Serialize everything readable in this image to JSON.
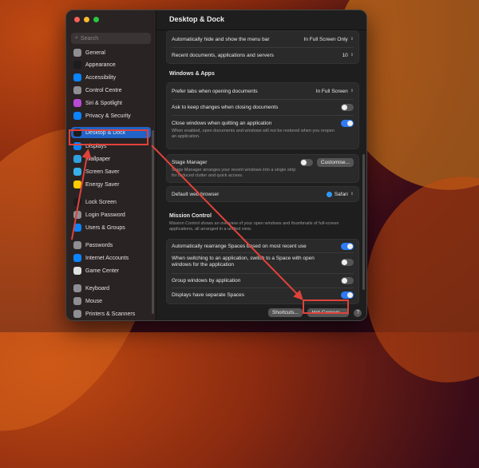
{
  "window": {
    "title": "Desktop & Dock"
  },
  "sidebar": {
    "search_placeholder": "Search",
    "items": [
      {
        "label": "General",
        "icon": "gear-icon",
        "color": "#8e8e93"
      },
      {
        "label": "Appearance",
        "icon": "appearance-icon",
        "color": "#1c1c1e"
      },
      {
        "label": "Accessibility",
        "icon": "accessibility-icon",
        "color": "#0a84ff"
      },
      {
        "label": "Control Centre",
        "icon": "control-centre-icon",
        "color": "#8e8e93"
      },
      {
        "label": "Siri & Spotlight",
        "icon": "siri-icon",
        "color": "#b84bd6"
      },
      {
        "label": "Privacy & Security",
        "icon": "hand-icon",
        "color": "#0a84ff"
      },
      {
        "label": "Desktop & Dock",
        "icon": "dock-icon",
        "color": "#1c1c1e"
      },
      {
        "label": "Displays",
        "icon": "display-icon",
        "color": "#0a84ff"
      },
      {
        "label": "Wallpaper",
        "icon": "wallpaper-icon",
        "color": "#30a0e0"
      },
      {
        "label": "Screen Saver",
        "icon": "screen-saver-icon",
        "color": "#38b0e8"
      },
      {
        "label": "Energy Saver",
        "icon": "battery-icon",
        "color": "#ffcc00"
      },
      {
        "label": "Lock Screen",
        "icon": "lock-icon",
        "color": "#1c1c1e"
      },
      {
        "label": "Login Password",
        "icon": "key-icon",
        "color": "#8e8e93"
      },
      {
        "label": "Users & Groups",
        "icon": "users-icon",
        "color": "#0a84ff"
      },
      {
        "label": "Passwords",
        "icon": "key-icon",
        "color": "#8e8e93"
      },
      {
        "label": "Internet Accounts",
        "icon": "at-icon",
        "color": "#0a84ff"
      },
      {
        "label": "Game Center",
        "icon": "game-center-icon",
        "color": "#e0e0e0"
      },
      {
        "label": "Keyboard",
        "icon": "keyboard-icon",
        "color": "#8e8e93"
      },
      {
        "label": "Mouse",
        "icon": "mouse-icon",
        "color": "#8e8e93"
      },
      {
        "label": "Printers & Scanners",
        "icon": "printer-icon",
        "color": "#8e8e93"
      }
    ]
  },
  "top_group": {
    "menu_bar_label": "Automatically hide and show the menu bar",
    "menu_bar_value": "In Full Screen Only",
    "recent_label": "Recent documents, applications and servers",
    "recent_value": "10"
  },
  "windows_apps": {
    "section_title": "Windows & Apps",
    "prefer_tabs_label": "Prefer tabs when opening documents",
    "prefer_tabs_value": "In Full Screen",
    "ask_keep_label": "Ask to keep changes when closing documents",
    "ask_keep_on": false,
    "close_windows_label": "Close windows when quitting an application",
    "close_windows_desc": "When enabled, open documents and windows will not be restored when you reopen an application.",
    "close_windows_on": true
  },
  "stage_manager": {
    "label": "Stage Manager",
    "desc": "Stage Manager arranges your recent windows into a single strip for reduced clutter and quick access.",
    "on": false,
    "customise_label": "Customise..."
  },
  "browser": {
    "label": "Default web browser",
    "value": "Safari"
  },
  "mission_control": {
    "section_title": "Mission Control",
    "desc": "Mission Control shows an overview of your open windows and thumbnails of full-screen applications, all arranged in a unified view.",
    "rearrange_label": "Automatically rearrange Spaces based on most recent use",
    "rearrange_on": true,
    "switch_label": "When switching to an application, switch to a Space with open windows for the application",
    "switch_on": false,
    "group_label": "Group windows by application",
    "group_on": false,
    "displays_label": "Displays have separate Spaces",
    "displays_on": true
  },
  "footer": {
    "shortcuts_label": "Shortcuts...",
    "hot_corners_label": "Hot Corners...",
    "help_label": "?"
  },
  "colors": {
    "accent": "#2f7bf5",
    "highlight": "#e0423a"
  }
}
